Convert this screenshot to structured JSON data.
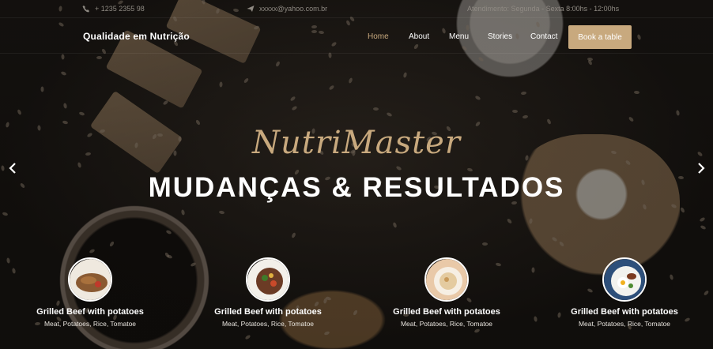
{
  "topbar": {
    "phone": "+ 1235 2355 98",
    "email": "xxxxx@yahoo.com.br",
    "hours": "Atendimento: Segunda - Sexta 8:00hs - 12:00hs"
  },
  "nav": {
    "brand": "Qualidade em Nutrição",
    "items": [
      {
        "label": "Home",
        "active": true
      },
      {
        "label": "About"
      },
      {
        "label": "Menu"
      },
      {
        "label": "Stories"
      },
      {
        "label": "Contact"
      }
    ],
    "cta": "Book a table"
  },
  "hero": {
    "script_title": "NutriMaster",
    "title": "MUDANÇAS & RESULTADOS"
  },
  "colors": {
    "accent": "#c8a97e",
    "background": "#1a1714"
  },
  "cards": [
    {
      "name": "Grilled Beef with potatoes",
      "desc": "Meat, Potatoes, Rice, Tomatoe"
    },
    {
      "name": "Grilled Beef with potatoes",
      "desc": "Meat, Potatoes, Rice, Tomatoe"
    },
    {
      "name": "Grilled Beef with potatoes",
      "desc": "Meat, Potatoes, Rice, Tomatoe"
    },
    {
      "name": "Grilled Beef with potatoes",
      "desc": "Meat, Potatoes, Rice, Tomatoe"
    }
  ],
  "icons": {
    "phone": "phone-icon",
    "email": "paper-plane-icon",
    "prev": "chevron-left-icon",
    "next": "chevron-right-icon"
  }
}
